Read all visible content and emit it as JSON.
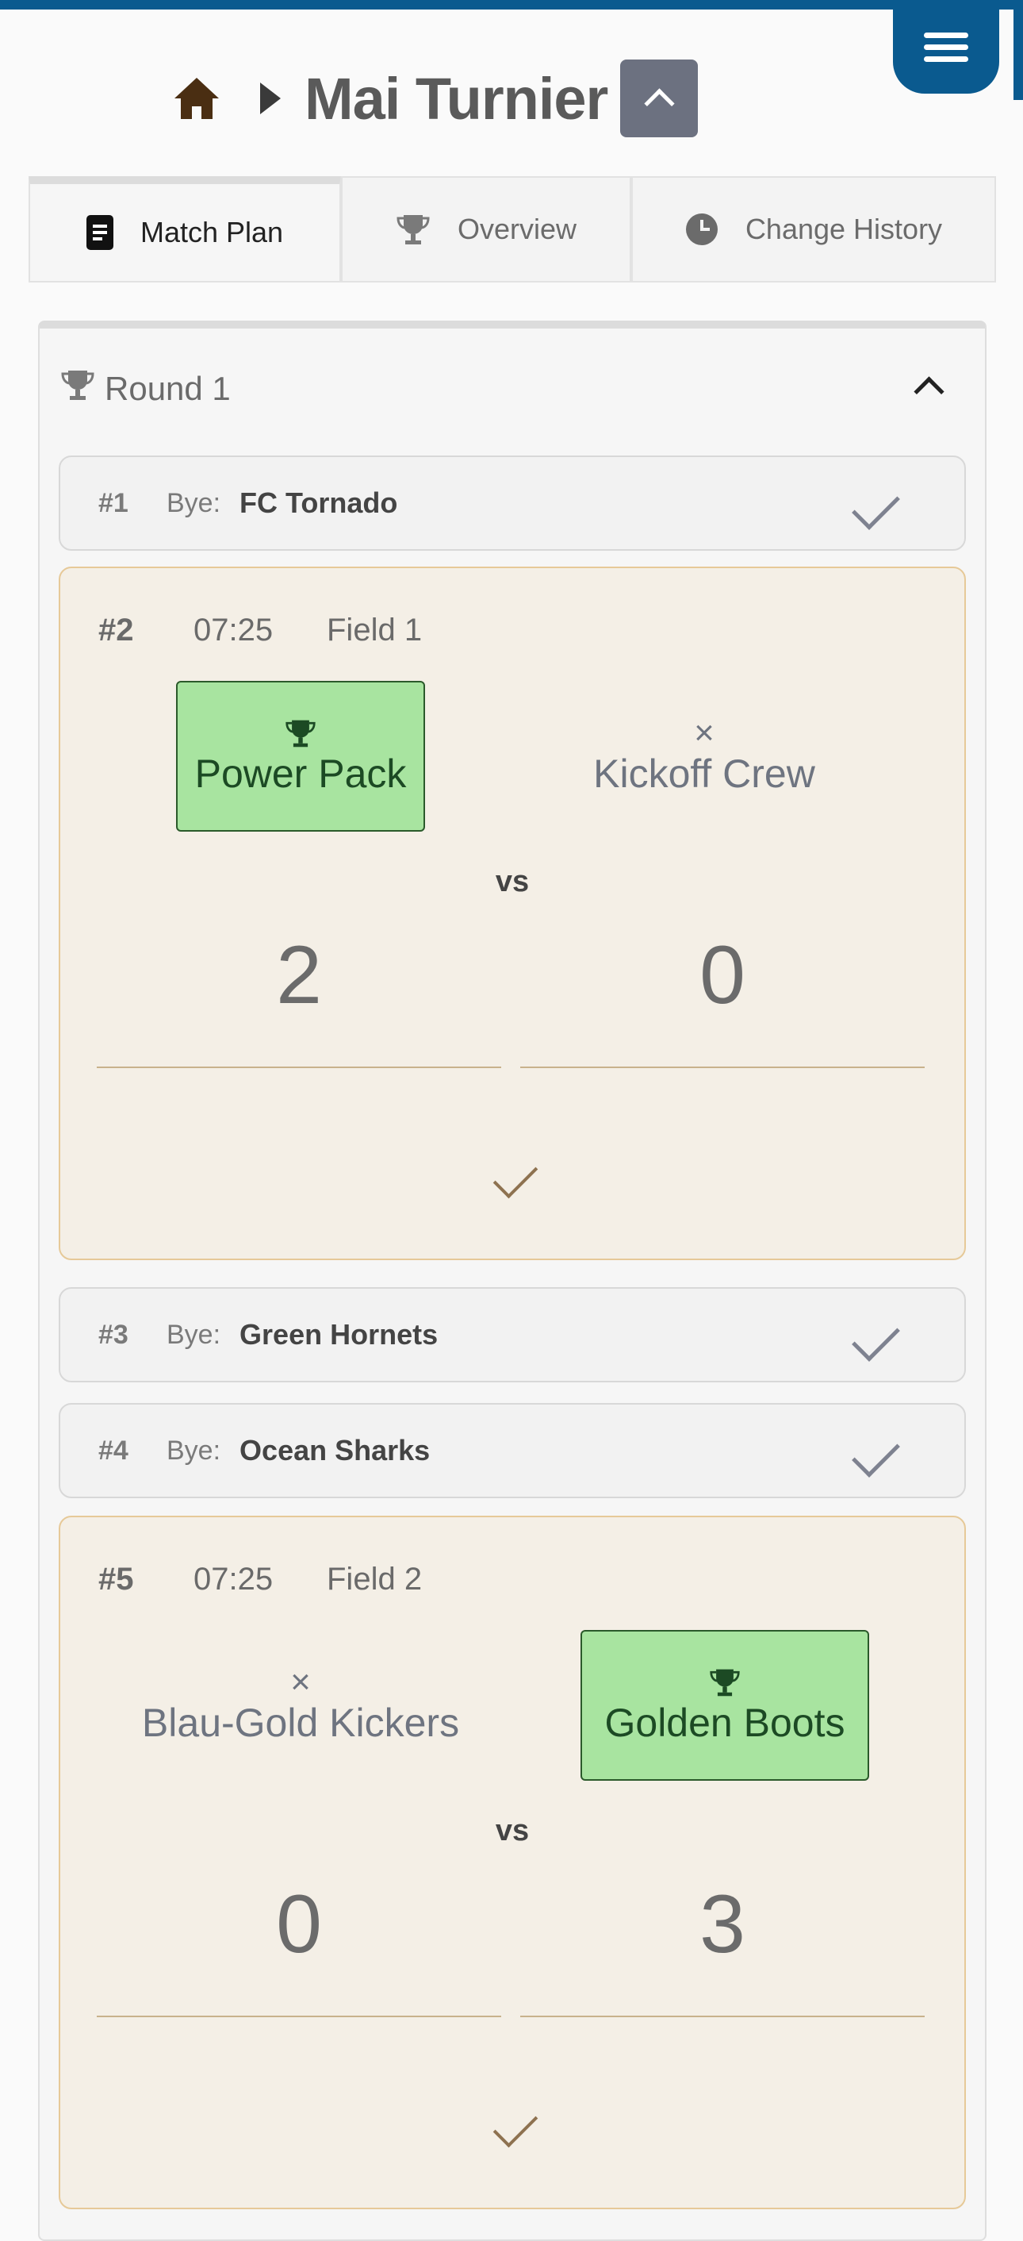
{
  "header": {
    "title": "Mai Turnier",
    "home_icon": "home-icon",
    "breadcrumb_icon": "caret-right-icon",
    "collapse_icon": "chevron-up-icon",
    "menu_icon": "hamburger-icon"
  },
  "tabs": [
    {
      "label": "Match Plan",
      "icon": "document-icon",
      "active": true
    },
    {
      "label": "Overview",
      "icon": "trophy-icon",
      "active": false
    },
    {
      "label": "Change History",
      "icon": "clock-icon",
      "active": false
    }
  ],
  "round": {
    "title": "Round 1",
    "icon": "trophy-icon",
    "collapse_icon": "chevron-up-icon"
  },
  "bye_label": "Bye:",
  "vs_label": "vs",
  "byes": [
    {
      "num": "#1",
      "team": "FC Tornado"
    },
    {
      "num": "#3",
      "team": "Green Hornets"
    },
    {
      "num": "#4",
      "team": "Ocean Sharks"
    }
  ],
  "matches": [
    {
      "num": "#2",
      "time": "07:25",
      "field": "Field 1",
      "home": {
        "name": "Power Pack",
        "result": "winner",
        "score": "2"
      },
      "away": {
        "name": "Kickoff Crew",
        "result": "loser",
        "score": "0"
      }
    },
    {
      "num": "#5",
      "time": "07:25",
      "field": "Field 2",
      "home": {
        "name": "Blau-Gold Kickers",
        "result": "loser",
        "score": "0"
      },
      "away": {
        "name": "Golden Boots",
        "result": "winner",
        "score": "3"
      }
    }
  ],
  "colors": {
    "brand": "#0a5a8f",
    "winner_bg": "#a8e4a0",
    "match_bg": "#f4efe6",
    "match_border": "#e6c998"
  }
}
